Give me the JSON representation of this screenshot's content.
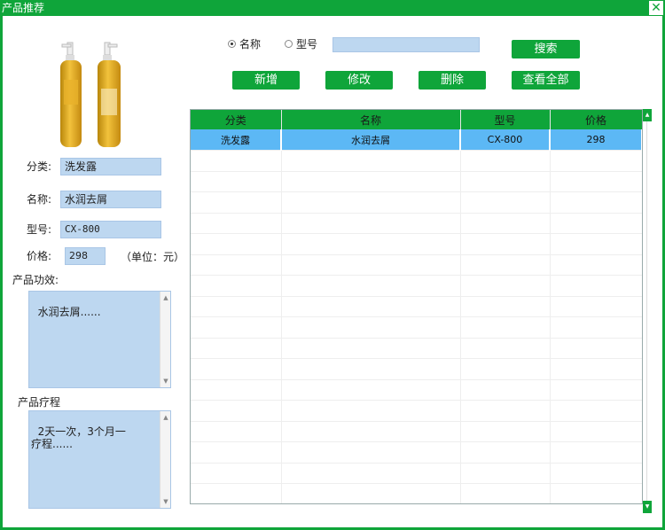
{
  "window": {
    "title": "产品推荐",
    "close_glyph": "✕"
  },
  "form": {
    "category_label": "分类:",
    "category_value": "洗发露",
    "name_label": "名称:",
    "name_value": "水润去屑",
    "model_label": "型号:",
    "model_value": "CX-800",
    "price_label": "价格:",
    "price_value": "298",
    "unit_text": "（单位：元）",
    "efficacy_label": "产品功效:",
    "efficacy_value": "水润去屑......",
    "course_label": "产品疗程",
    "course_value": "2天一次，3个月一疗程......"
  },
  "search": {
    "radio_name_label": "名称",
    "radio_name_checked": true,
    "radio_model_label": "型号",
    "radio_model_checked": false,
    "query": "",
    "search_button": "搜索"
  },
  "actions": {
    "add": "新增",
    "edit": "修改",
    "delete": "删除",
    "view_all": "查看全部"
  },
  "table": {
    "headers": [
      "分类",
      "名称",
      "型号",
      "价格"
    ],
    "rows": [
      [
        "洗发露",
        "水润去屑",
        "CX-800",
        "298"
      ]
    ]
  },
  "colors": {
    "accent": "#0fa53a",
    "input_bg": "#bdd7f0",
    "selected_row": "#5cb8f5"
  },
  "icons": {
    "close": "close-icon",
    "scroll_up": "chevron-up-icon",
    "scroll_down": "chevron-down-icon"
  }
}
